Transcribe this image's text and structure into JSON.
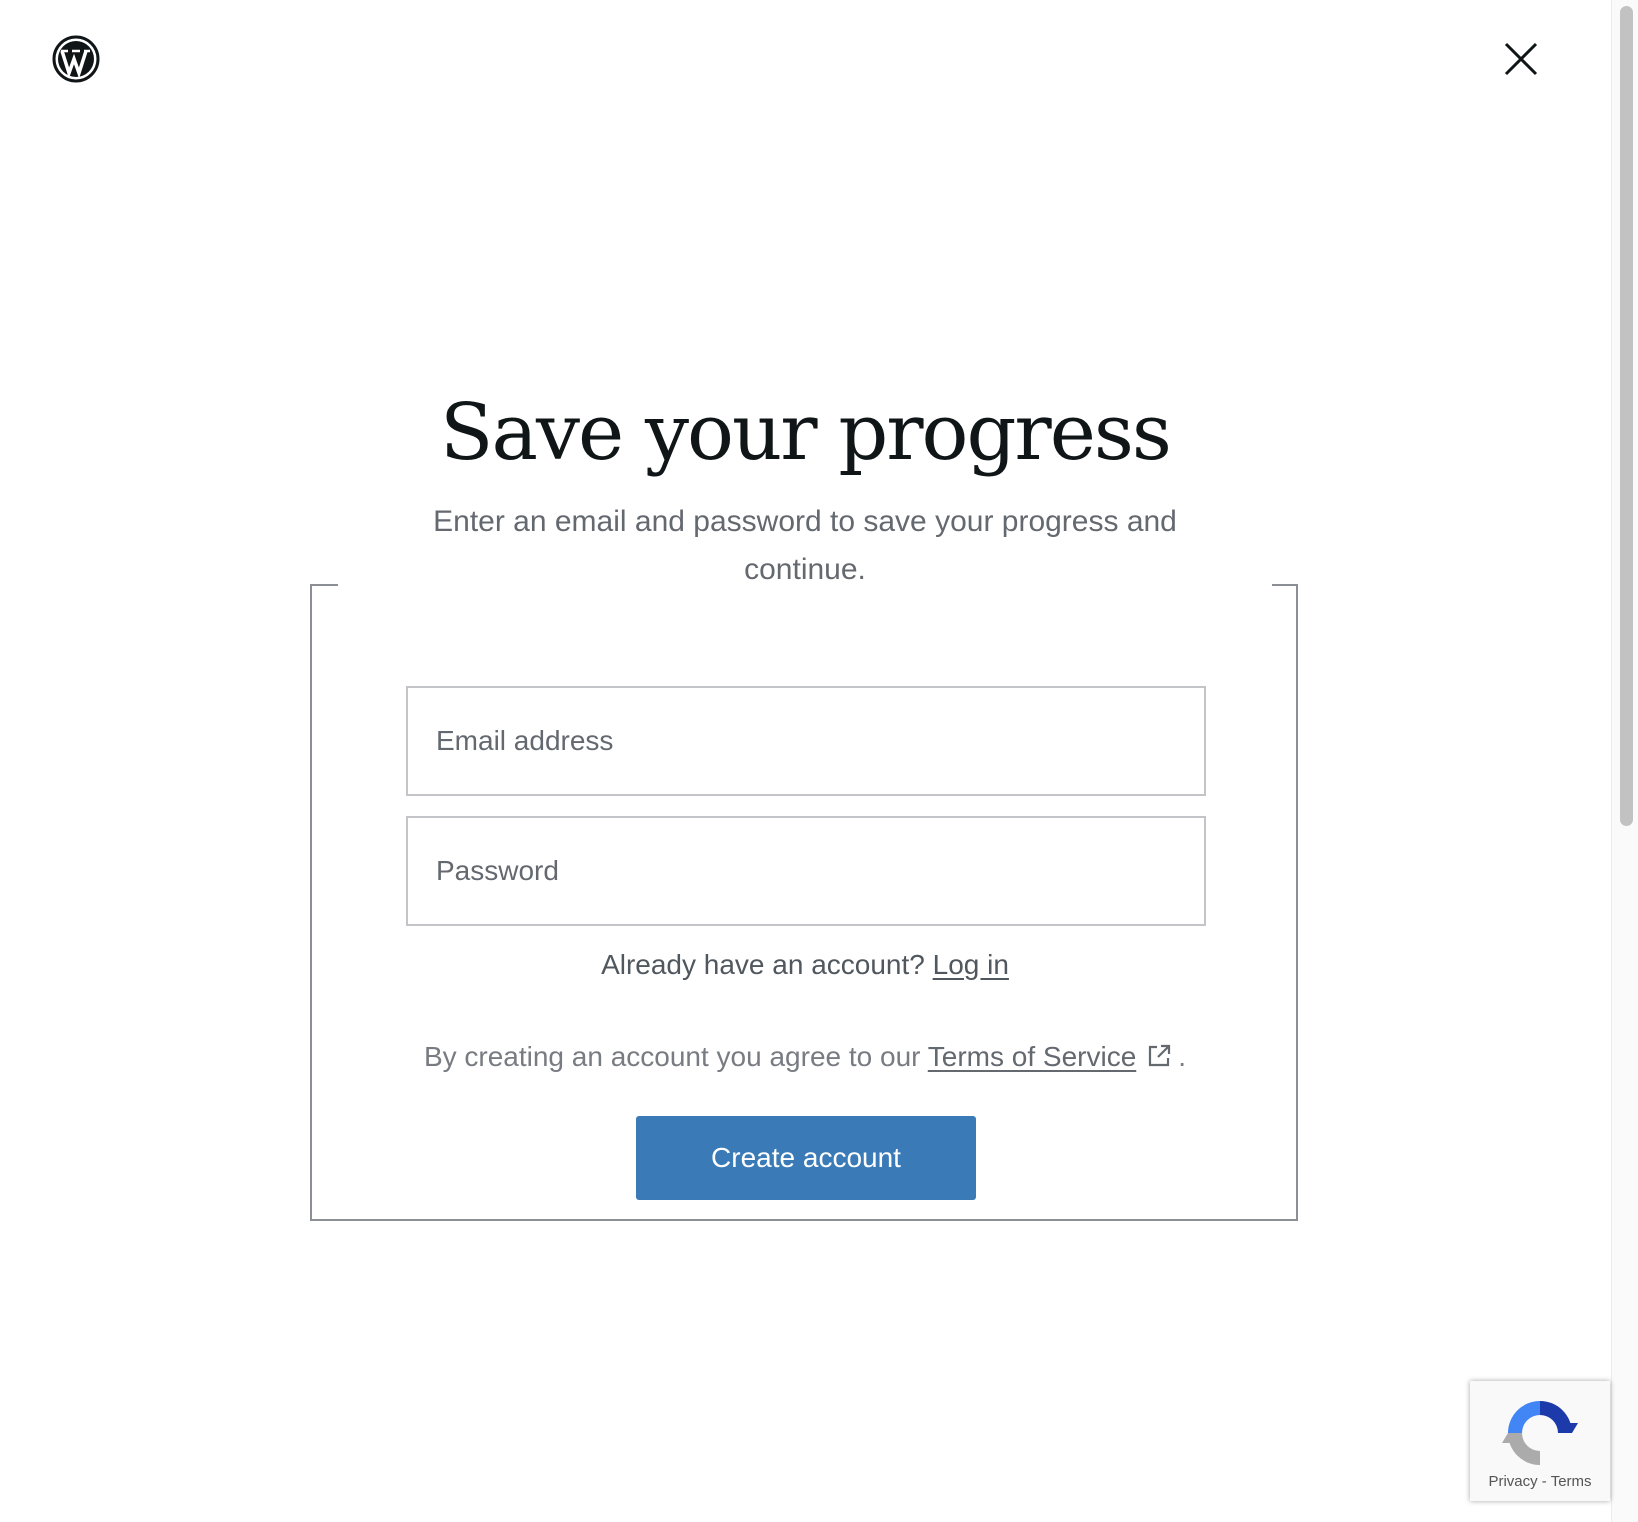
{
  "header": {
    "logo_icon": "wordpress-logo-icon",
    "close_icon": "close-icon"
  },
  "main": {
    "title": "Save your progress",
    "subtitle": "Enter an email and password to save your progress and continue.",
    "email_placeholder": "Email address",
    "password_placeholder": "Password",
    "login_prompt": "Already have an account?",
    "login_link": "Log in",
    "tos_prefix": "By creating an account you agree to our",
    "tos_link": "Terms of Service",
    "tos_suffix": ".",
    "external_link_icon": "external-link-icon",
    "create_button": "Create account"
  },
  "recaptcha": {
    "icon": "recaptcha-icon",
    "privacy": "Privacy",
    "separator": "-",
    "terms": "Terms"
  },
  "colors": {
    "primary_button": "#3a7bb7",
    "text_dark": "#101517",
    "text_muted": "#646970"
  }
}
